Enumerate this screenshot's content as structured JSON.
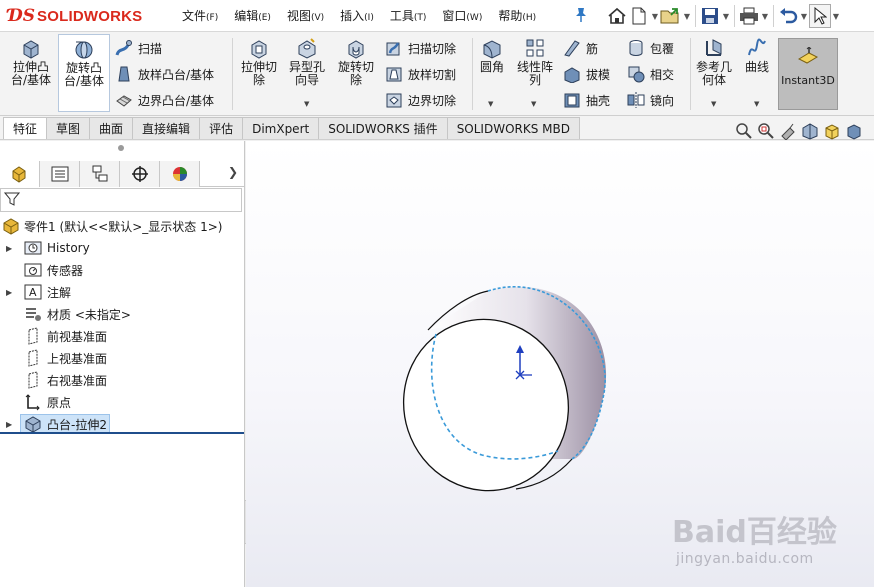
{
  "app": {
    "logo_text": "SOLIDWORKS",
    "brand_color": "#da291c"
  },
  "menubar": {
    "items": [
      {
        "label": "文件",
        "key": "(F)"
      },
      {
        "label": "编辑",
        "key": "(E)"
      },
      {
        "label": "视图",
        "key": "(V)"
      },
      {
        "label": "插入",
        "key": "(I)"
      },
      {
        "label": "工具",
        "key": "(T)"
      },
      {
        "label": "窗口",
        "key": "(W)"
      },
      {
        "label": "帮助",
        "key": "(H)"
      }
    ]
  },
  "quick_access": {
    "icons": [
      "home-icon",
      "new-document-icon",
      "open-icon",
      "save-icon",
      "print-icon",
      "undo-icon",
      "select-cursor-icon"
    ]
  },
  "ribbon": {
    "extrude_boss": "拉伸凸\n台/基体",
    "revolve_boss": "旋转凸\n台/基体",
    "sweep": "扫描",
    "loft_boss": "放样凸台/基体",
    "boundary_boss": "边界凸台/基体",
    "extrude_cut": "拉伸切\n除",
    "hole_wizard": "异型孔\n向导",
    "revolve_cut": "旋转切\n除",
    "sweep_cut": "扫描切除",
    "loft_cut": "放样切割",
    "boundary_cut": "边界切除",
    "fillet": "圆角",
    "linear_pattern": "线性阵\n列",
    "rib": "筋",
    "draft": "拔模",
    "shell": "抽壳",
    "wrap": "包覆",
    "intersect": "相交",
    "mirror": "镜向",
    "reference_geometry": "参考几\n何体",
    "curves": "曲线",
    "instant3d": "Instant3D"
  },
  "tabs": [
    {
      "label": "特征",
      "active": true
    },
    {
      "label": "草图",
      "active": false
    },
    {
      "label": "曲面",
      "active": false
    },
    {
      "label": "直接编辑",
      "active": false
    },
    {
      "label": "评估",
      "active": false
    },
    {
      "label": "DimXpert",
      "active": false
    },
    {
      "label": "SOLIDWORKS 插件",
      "active": false
    },
    {
      "label": "SOLIDWORKS MBD",
      "active": false
    }
  ],
  "feature_tree": {
    "part": "零件1  (默认<<默认>_显示状态 1>)",
    "items": [
      {
        "label": "History",
        "expandable": true,
        "icon": "history-folder-icon"
      },
      {
        "label": "传感器",
        "expandable": false,
        "icon": "sensor-icon"
      },
      {
        "label": "注解",
        "expandable": true,
        "icon": "annotation-icon"
      },
      {
        "label": "材质 <未指定>",
        "expandable": false,
        "icon": "material-icon"
      },
      {
        "label": "前视基准面",
        "expandable": false,
        "icon": "plane-icon"
      },
      {
        "label": "上视基准面",
        "expandable": false,
        "icon": "plane-icon"
      },
      {
        "label": "右视基准面",
        "expandable": false,
        "icon": "plane-icon"
      },
      {
        "label": "原点",
        "expandable": false,
        "icon": "origin-icon"
      },
      {
        "label": "凸台-拉伸2",
        "expandable": true,
        "icon": "extrude-feature-icon",
        "selected": true
      }
    ]
  },
  "viewport": {
    "edge_highlight_color": "#3a9ad9",
    "axis_color": "#1f3fbf"
  },
  "watermark": {
    "title": "Baid百经验",
    "url": "jingyan.baidu.com"
  }
}
